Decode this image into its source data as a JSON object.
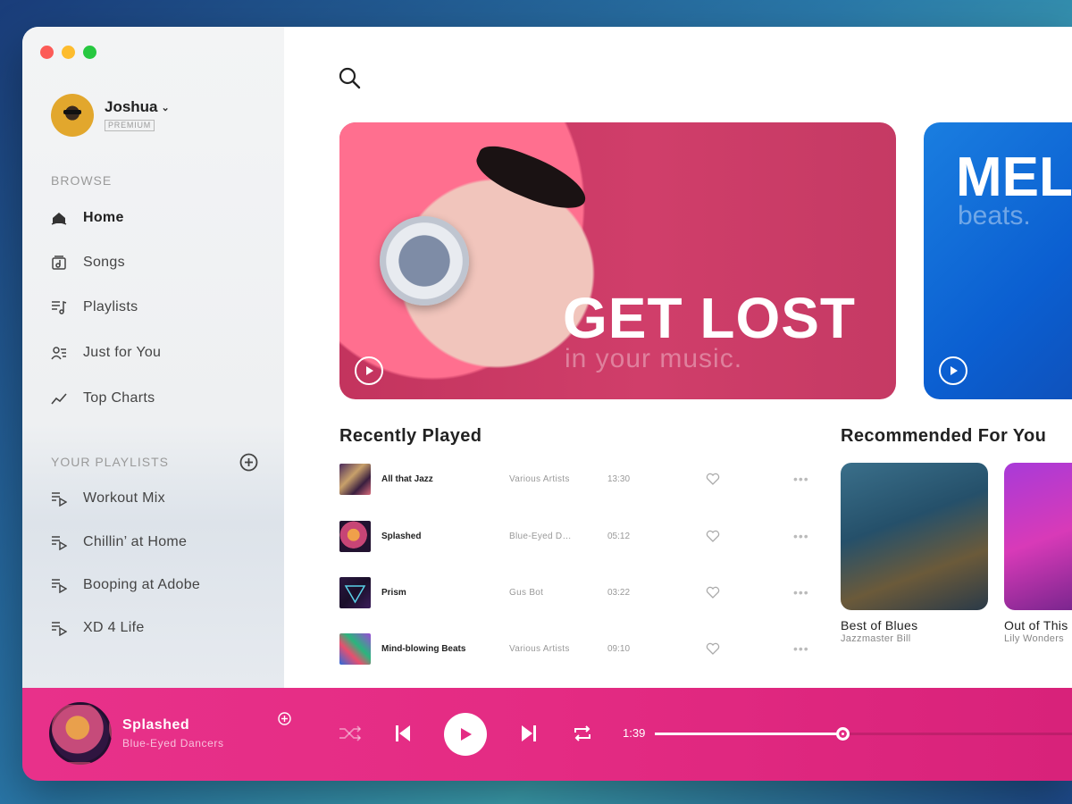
{
  "user": {
    "name": "Joshua",
    "badge": "PREMIUM"
  },
  "sidebar": {
    "browse_title": "BROWSE",
    "browse_items": [
      {
        "label": "Home",
        "icon": "home-icon",
        "active": true
      },
      {
        "label": "Songs",
        "icon": "songs-icon"
      },
      {
        "label": "Playlists",
        "icon": "playlists-icon"
      },
      {
        "label": "Just for You",
        "icon": "just-for-you-icon"
      },
      {
        "label": "Top Charts",
        "icon": "top-charts-icon"
      }
    ],
    "playlists_title": "YOUR PLAYLISTS",
    "playlists": [
      {
        "label": "Workout Mix"
      },
      {
        "label": "Chillin’ at Home"
      },
      {
        "label": "Booping at Adobe"
      },
      {
        "label": "XD 4 Life"
      }
    ]
  },
  "hero": {
    "title": "GET LOST",
    "subtitle": "in your music."
  },
  "hero2": {
    "title": "MEL",
    "subtitle": "beats."
  },
  "recently_played": {
    "title": "Recently Played",
    "tracks": [
      {
        "title": "All that Jazz",
        "artist": "Various Artists",
        "duration": "13:30"
      },
      {
        "title": "Splashed",
        "artist": "Blue-Eyed D…",
        "duration": "05:12"
      },
      {
        "title": "Prism",
        "artist": "Gus Bot",
        "duration": "03:22"
      },
      {
        "title": "Mind-blowing Beats",
        "artist": "Various Artists",
        "duration": "09:10"
      }
    ]
  },
  "recommended": {
    "title": "Recommended For You",
    "cards": [
      {
        "title": "Best of Blues",
        "artist": "Jazzmaster Bill"
      },
      {
        "title": "Out of This",
        "artist": "Lily Wonders"
      }
    ]
  },
  "player": {
    "title": "Splashed",
    "artist": "Blue-Eyed Dancers",
    "elapsed": "1:39",
    "progress": 0.45
  },
  "colors": {
    "accent": "#e42b83",
    "hero_bg": "#c8385f",
    "hero2_bg": "#0b5fd1"
  }
}
